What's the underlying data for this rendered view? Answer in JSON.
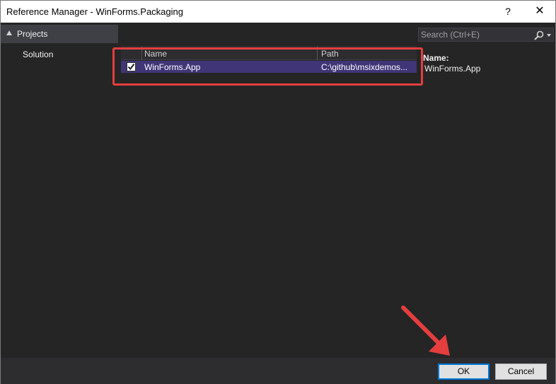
{
  "window": {
    "title": "Reference Manager - WinForms.Packaging",
    "help_label": "?",
    "close_label": "✕"
  },
  "sidebar": {
    "section_label": "Projects",
    "items": [
      {
        "label": "Solution"
      }
    ]
  },
  "grid": {
    "columns": [
      {
        "label": "Name"
      },
      {
        "label": "Path"
      }
    ],
    "rows": [
      {
        "checked": true,
        "name": "WinForms.App",
        "path": "C:\\github\\msixdemos..."
      }
    ]
  },
  "search": {
    "placeholder": "Search (Ctrl+E)",
    "icon": "search-icon"
  },
  "details": {
    "name_label": "Name:",
    "name_value": "WinForms.App"
  },
  "footer": {
    "ok_label": "OK",
    "cancel_label": "Cancel"
  },
  "annotations": {
    "highlight_color": "#e53e3e",
    "arrow_color": "#e53e3e"
  }
}
